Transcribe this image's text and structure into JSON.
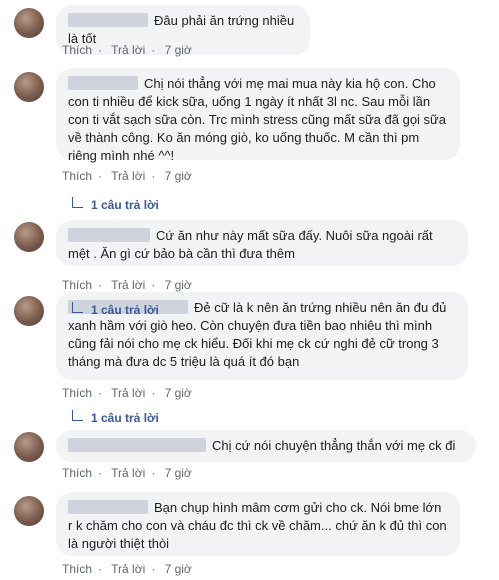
{
  "comments": [
    {
      "text": "Đâu phải ăn trứng nhiều là tốt",
      "like": "Thích",
      "reply": "Trả lời",
      "time": "7 giờ"
    },
    {
      "text": "Chị nói thẳng với mẹ mai mua này kia hộ con. Cho con ti nhiều để kick sữa, uống 1 ngày ít nhất 3l nc. Sau mỗi lần con ti vắt sạch sữa còn. Trc mình stress cũng mất sữa đã gọi sữa về thành công. Ko ăn móng giò, ko uống thuốc. M cần thì pm riêng mình nhé ^^!",
      "like": "Thích",
      "reply": "Trả lời",
      "time": "7 giờ",
      "replies": "1 câu trả lời"
    },
    {
      "text": "Cứ ăn như này mất sữa đấy. Nuôi sữa ngoài rất mệt . Ăn gì cứ bảo bà cần thì đưa thêm",
      "like": "Thích",
      "reply": "Trả lời",
      "time": "7 giờ",
      "replies": "1 câu trả lời"
    },
    {
      "text": "Đẻ cữ là k nên ăn trứng nhiều nên ăn đu đủ xanh hầm với giò heo. Còn chuyện đưa tiền bao nhiêu thì mình cũng fải nói cho mẹ ck hiểu. Đối khi mẹ ck cứ nghi đẻ cữ trong 3 tháng mà đưa dc 5 triệu là quá ít đó bạn",
      "like": "Thích",
      "reply": "Trả lời",
      "time": "7 giờ",
      "replies": "1 câu trả lời"
    },
    {
      "text": "Chị cứ nói chuyện thẳng thắn với mẹ ck đi",
      "like": "Thích",
      "reply": "Trả lời",
      "time": "7 giờ"
    },
    {
      "text": "Bạn chụp hình mâm cơm gửi cho ck. Nói bme lớn r k chăm cho con và cháu đc thì ck về chăm... chứ ăn k đủ thì con là người thiệt thòi",
      "like": "Thích",
      "reply": "Trả lời",
      "time": "7 giờ"
    }
  ]
}
